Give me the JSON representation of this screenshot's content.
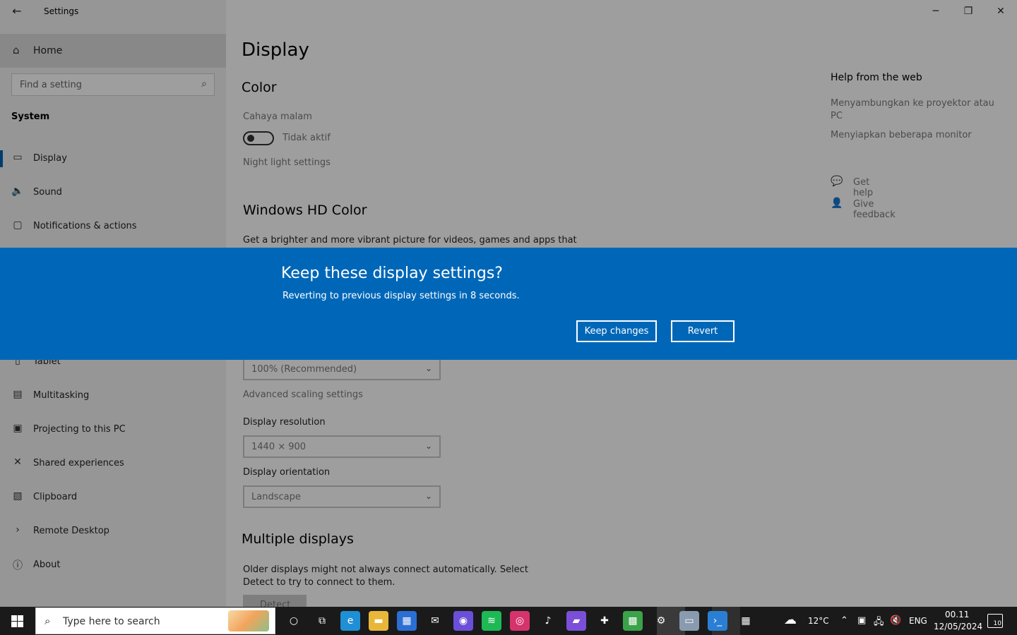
{
  "window": {
    "app_title": "Settings",
    "controls": {
      "minimize": "─",
      "restore": "❐",
      "close": "✕"
    }
  },
  "sidebar": {
    "home_label": "Home",
    "search_placeholder": "Find a setting",
    "section": "System",
    "items": [
      {
        "label": "Display",
        "icon": "monitor-icon",
        "glyph": "▭"
      },
      {
        "label": "Sound",
        "icon": "speaker-icon",
        "glyph": "🔈"
      },
      {
        "label": "Notifications & actions",
        "icon": "notification-icon",
        "glyph": "▢"
      },
      {
        "label": "Tablet",
        "icon": "tablet-icon",
        "glyph": "▯"
      },
      {
        "label": "Multitasking",
        "icon": "multitasking-icon",
        "glyph": "▤"
      },
      {
        "label": "Projecting to this PC",
        "icon": "projecting-icon",
        "glyph": "▣"
      },
      {
        "label": "Shared experiences",
        "icon": "shared-icon",
        "glyph": "✕"
      },
      {
        "label": "Clipboard",
        "icon": "clipboard-icon",
        "glyph": "▧"
      },
      {
        "label": "Remote Desktop",
        "icon": "remote-desktop-icon",
        "glyph": "›"
      },
      {
        "label": "About",
        "icon": "info-icon",
        "glyph": "ⓘ"
      }
    ]
  },
  "main": {
    "title": "Display",
    "color_heading": "Color",
    "night_light_label": "Cahaya malam",
    "night_light_state": "Tidak aktif",
    "night_light_link": "Night light settings",
    "hd_color_heading": "Windows HD Color",
    "hd_color_desc": "Get a brighter and more vibrant picture for videos, games and apps that",
    "scale_value": "100% (Recommended)",
    "advanced_scaling_link": "Advanced scaling settings",
    "resolution_label": "Display resolution",
    "resolution_value": "1440 × 900",
    "orientation_label": "Display orientation",
    "orientation_value": "Landscape",
    "multiple_displays_heading": "Multiple displays",
    "multiple_displays_desc": "Older displays might not always connect automatically. Select Detect to try to connect to them.",
    "detect_button": "Detect"
  },
  "help": {
    "title": "Help from the web",
    "links": [
      "Menyambungkan ke proyektor atau PC",
      "Menyiapkan beberapa monitor"
    ],
    "get_help": "Get help",
    "give_feedback": "Give feedback"
  },
  "dialog": {
    "title": "Keep these display settings?",
    "message": "Reverting to previous display settings in  8 seconds.",
    "keep_button": "Keep changes",
    "revert_button": "Revert"
  },
  "taskbar": {
    "search_placeholder": "Type here to search",
    "weather": "12°C",
    "language": "ENG",
    "time": "00.11",
    "date": "12/05/2024",
    "notification_count": "10",
    "apps": [
      {
        "name": "cortana-icon",
        "glyph": "○",
        "color": "transparent"
      },
      {
        "name": "task-view-icon",
        "glyph": "⧉",
        "color": "transparent"
      },
      {
        "name": "edge-icon",
        "glyph": "e",
        "color": "#1f8fd6"
      },
      {
        "name": "file-explorer-icon",
        "glyph": "▬",
        "color": "#e8b73a"
      },
      {
        "name": "store-icon",
        "glyph": "▦",
        "color": "#2b6fd4"
      },
      {
        "name": "mail-icon",
        "glyph": "✉",
        "color": "transparent"
      },
      {
        "name": "firefox-icon",
        "glyph": "◉",
        "color": "#6b4fd8"
      },
      {
        "name": "spotify-icon",
        "glyph": "≋",
        "color": "#1db954"
      },
      {
        "name": "instagram-icon",
        "glyph": "◎",
        "color": "#d6336c"
      },
      {
        "name": "tiktok-icon",
        "glyph": "♪",
        "color": "transparent"
      },
      {
        "name": "video-editor-icon",
        "glyph": "▰",
        "color": "#7b4fd8"
      },
      {
        "name": "puzzle-icon",
        "glyph": "✚",
        "color": "transparent"
      },
      {
        "name": "minecraft-icon",
        "glyph": "▩",
        "color": "#3aa34a"
      },
      {
        "name": "settings-icon",
        "glyph": "⚙",
        "color": "transparent"
      },
      {
        "name": "monitor-app-icon",
        "glyph": "▭",
        "color": "#8a9bb0"
      },
      {
        "name": "terminal-icon",
        "glyph": "›_",
        "color": "#2a7fd4"
      },
      {
        "name": "calendar-icon",
        "glyph": "▦",
        "color": "transparent"
      }
    ]
  },
  "colors": {
    "accent": "#0067b8",
    "sidebar_bg": "#f2f2f2",
    "taskbar_bg": "#1a1a1a"
  }
}
